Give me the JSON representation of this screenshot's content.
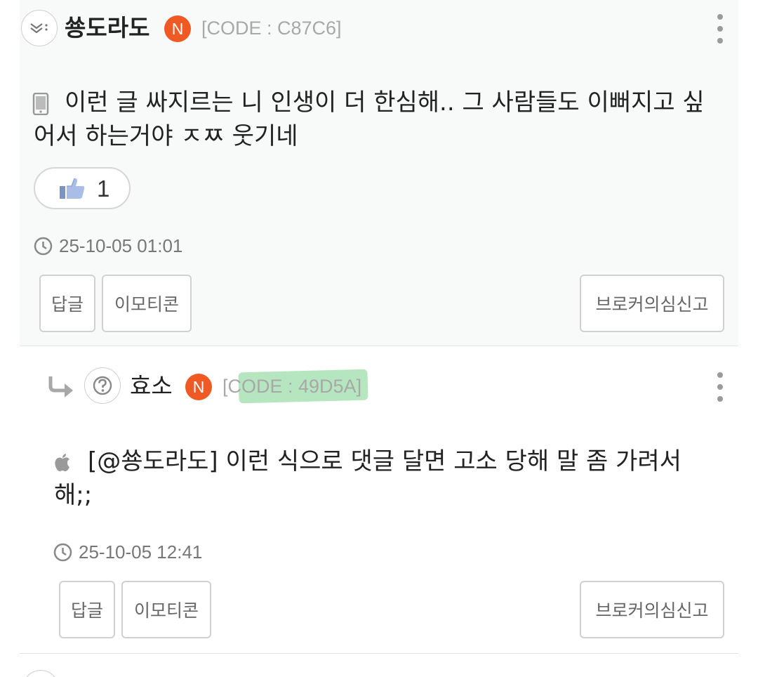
{
  "comments": [
    {
      "username": "쑝도라도",
      "badge": "N",
      "code": "[CODE : C87C6]",
      "body": "이런 글 싸지르는 니 인생이 더 한심해.. 그 사람들도 이뻐지고 싶어서 하는거야 ㅈㅉ 웃기네",
      "device_icon": "mobile-phone-icon",
      "likes": "1",
      "timestamp": "25-10-05 01:01",
      "reply_label": "답글",
      "emoticon_label": "이모티콘",
      "report_label": "브로커의심신고"
    }
  ],
  "replies": [
    {
      "username": "효소",
      "badge": "N",
      "code": "[CODE : 49D5A]",
      "body": "[@쑝도라도] 이런 식으로 댓글 달면 고소 당해 말 좀 가려서 해;;",
      "device_icon": "apple-icon",
      "timestamp": "25-10-05 12:41",
      "reply_label": "답글",
      "emoticon_label": "이모티콘",
      "report_label": "브로커의심신고"
    }
  ],
  "colors": {
    "badge": "#ef5a24",
    "highlight": "#78d28c",
    "comment_bg": "#f7faf9"
  }
}
